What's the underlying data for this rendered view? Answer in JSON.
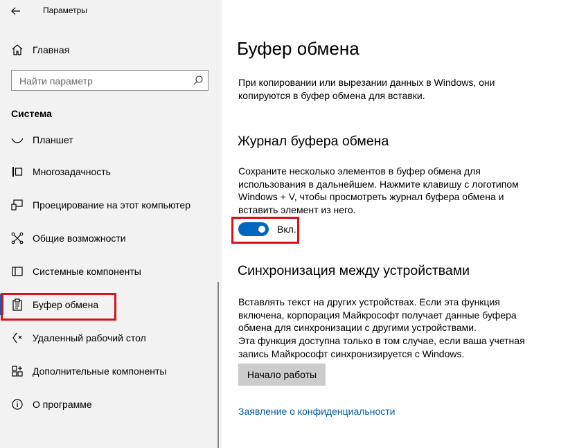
{
  "window": {
    "title": "Параметры"
  },
  "sidebar": {
    "home_label": "Главная",
    "search": {
      "placeholder": "Найти параметр"
    },
    "section_title": "Система",
    "items": [
      {
        "label": "Планшет",
        "icon": "tablet-icon"
      },
      {
        "label": "Многозадачность",
        "icon": "multitasking-icon"
      },
      {
        "label": "Проецирование на этот компьютер",
        "icon": "projecting-icon"
      },
      {
        "label": "Общие возможности",
        "icon": "shared-experiences-icon"
      },
      {
        "label": "Системные компоненты",
        "icon": "system-components-icon"
      },
      {
        "label": "Буфер обмена",
        "icon": "clipboard-icon",
        "selected": true
      },
      {
        "label": "Удаленный рабочий стол",
        "icon": "remote-desktop-icon"
      },
      {
        "label": "Дополнительные компоненты",
        "icon": "optional-features-icon"
      },
      {
        "label": "О программе",
        "icon": "about-icon"
      }
    ]
  },
  "main": {
    "title": "Буфер обмена",
    "intro": "При копировании или вырезании данных в Windows, они копируются в буфер обмена для вставки.",
    "history": {
      "heading": "Журнал буфера обмена",
      "description": "Сохраните несколько элементов в буфер обмена для использования в дальнейшем. Нажмите клавишу с логотипом Windows + V, чтобы просмотреть журнал буфера обмена и вставить элемент из него.",
      "toggle_state": "on",
      "toggle_label": "Вкл."
    },
    "sync": {
      "heading": "Синхронизация между устройствами",
      "description_1": "Вставлять текст на других устройствах. Если эта функция включена, корпорация Майкрософт получает данные буфера обмена для синхронизации с другими устройствами.",
      "description_2": "Эта функция доступна только в том случае, если ваша учетная запись Майкрософт синхронизируется с Windows.",
      "button_label": "Начало работы"
    },
    "privacy_link": "Заявление о конфиденциальности"
  },
  "colors": {
    "accent": "#0067c0",
    "highlight_box": "#d8101a",
    "sidebar_bg": "#f2f2f2",
    "link": "#005a9e"
  }
}
